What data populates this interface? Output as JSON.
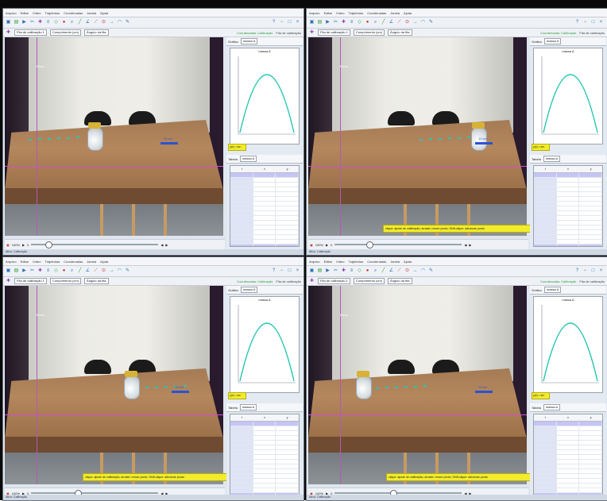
{
  "app": {
    "menus": [
      "Arquivo",
      "Editar",
      "Vídeo",
      "Trajetórias",
      "Coordenadas",
      "Janela",
      "Ajuda"
    ],
    "toolbar_zoom": "Ajuda",
    "calibration_field": "Fita de calibração 1",
    "length_field": "Comprimento (cm)",
    "angle_field": "Ângulo da fita",
    "status_green": "Coordenadas: Calibração",
    "status_gray": "Fita de calibração"
  },
  "side": {
    "tab_graph": "Gráfico",
    "graph_selector": "massa A",
    "plot_title": "massa A",
    "tab_table": "Tabela",
    "table_selector": "massa A",
    "table_cols": [
      "t",
      "x",
      "y"
    ],
    "mini_yellow": "y(x) = ax²"
  },
  "playback": {
    "speed": "100%",
    "frame": "0"
  },
  "notes": {
    "hint": "clique: ajuste de calibração; arraste: mover ponto; Shift-clique: adicionar ponto"
  },
  "status_bottom": "Ativo: Calibração",
  "colors": {
    "track": "#27c6b1",
    "axis_line": "#d04fd0",
    "calib": "#2b53d1",
    "note": "#f2ec2a"
  },
  "panels": [
    {
      "id": "top-left",
      "marker": "Eixos",
      "calib_label": "10 cm"
    },
    {
      "id": "top-right",
      "marker": "Eixos",
      "calib_label": "10 cm"
    },
    {
      "id": "bottom-left",
      "marker": "Eixos",
      "calib_label": "10 cm"
    },
    {
      "id": "bottom-right",
      "marker": "Eixos",
      "calib_label": "10 cm"
    }
  ]
}
